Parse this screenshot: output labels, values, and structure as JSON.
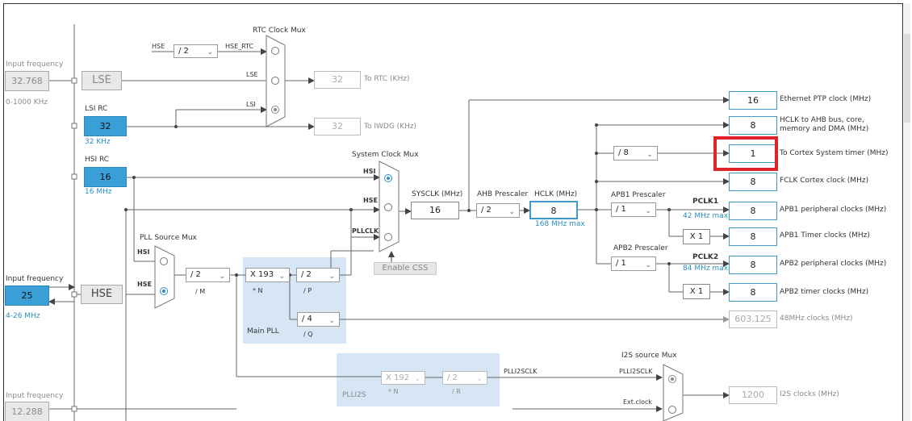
{
  "left": {
    "lse_input": {
      "title": "Input frequency",
      "value": "32.768",
      "range": "0-1000 KHz"
    },
    "lse_label": "LSE",
    "lsi": {
      "title": "LSI RC",
      "value": "32",
      "unit": "32 KHz"
    },
    "hsi": {
      "title": "HSI RC",
      "value": "16",
      "unit": "16 MHz"
    },
    "hse_input": {
      "title": "Input frequency",
      "value": "25",
      "range": "4-26 MHz"
    },
    "hse_label": "HSE",
    "i2s_input": {
      "title": "Input frequency",
      "value": "12.288"
    }
  },
  "rtc": {
    "mux_title": "RTC Clock Mux",
    "hse_in": "HSE",
    "div": "/ 2",
    "hse_rtc": "HSE_RTC",
    "lse": "LSE",
    "lsi": "LSI",
    "rtc_value": "32",
    "rtc_label": "To RTC (KHz)",
    "iwdg_value": "32",
    "iwdg_label": "To IWDG (KHz)"
  },
  "pll_src": {
    "title": "PLL Source Mux",
    "hsi": "HSI",
    "hse": "HSE",
    "m_div": "/ 2",
    "m_label": "/ M"
  },
  "main_pll": {
    "n_mul": "X 193",
    "n_label": "* N",
    "p_div": "/ 2",
    "p_label": "/ P",
    "q_div": "/ 4",
    "q_label": "/ Q",
    "title": "Main PLL"
  },
  "sys_mux": {
    "title": "System Clock Mux",
    "hsi": "HSI",
    "hse": "HSE",
    "pllclk": "PLLCLK",
    "enable_css": "Enable CSS"
  },
  "sysclk": {
    "label": "SYSCLK (MHz)",
    "value": "16"
  },
  "ahb": {
    "label": "AHB Prescaler",
    "div": "/ 2"
  },
  "hclk": {
    "label": "HCLK (MHz)",
    "value": "8",
    "max": "168 MHz max"
  },
  "cortex_div": "/ 8",
  "apb1": {
    "label": "APB1 Prescaler",
    "div": "/ 1",
    "pclk": "PCLK1",
    "max": "42 MHz max",
    "timer_mul": "X 1"
  },
  "apb2": {
    "label": "APB2 Prescaler",
    "div": "/ 1",
    "pclk": "PCLK2",
    "max": "84 MHz max",
    "timer_mul": "X 1"
  },
  "outputs": [
    {
      "value": "16",
      "label": "Ethernet PTP clock (MHz)"
    },
    {
      "value": "8",
      "label": "HCLK to AHB bus, core,",
      "label2": "memory and DMA (MHz)"
    },
    {
      "value": "1",
      "label": "To Cortex System timer (MHz)"
    },
    {
      "value": "8",
      "label": "FCLK Cortex clock (MHz)"
    },
    {
      "value": "8",
      "label": "APB1 peripheral clocks (MHz)"
    },
    {
      "value": "8",
      "label": "APB1 Timer clocks (MHz)"
    },
    {
      "value": "8",
      "label": "APB2 peripheral clocks (MHz)"
    },
    {
      "value": "8",
      "label": "APB2 timer clocks (MHz)"
    }
  ],
  "usb48": {
    "value": "603.125",
    "label": "48MHz clocks (MHz)"
  },
  "plli2s": {
    "title": "PLLI2S",
    "n_mul": "X 192",
    "n_label": "* N",
    "r_div": "/ 2",
    "r_label": "/ R",
    "out": "PLLI2SCLK"
  },
  "i2s_mux": {
    "title": "I2S source Mux",
    "plli2sclk": "PLLI2SCLK",
    "ext": "Ext.clock",
    "value": "1200",
    "label": "I2S clocks (MHz)"
  },
  "colors": {
    "accent": "#3a9fd6",
    "highlight": "#e0242b",
    "panel": "#d6e6f4"
  }
}
